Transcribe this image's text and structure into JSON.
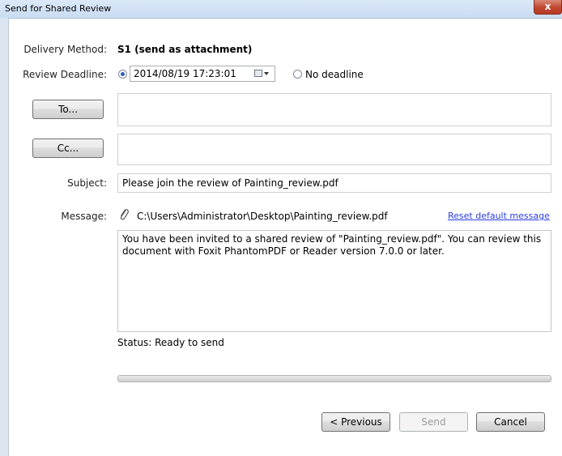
{
  "window": {
    "title": "Send for Shared Review",
    "close_glyph": "x"
  },
  "delivery": {
    "label": "Delivery Method:",
    "value": "S1 (send as attachment)"
  },
  "deadline": {
    "label": "Review Deadline:",
    "datetime": "2014/08/19  17:23:01",
    "no_deadline_label": "No deadline",
    "selected": "date"
  },
  "to_button": "To...",
  "cc_button": "Cc...",
  "to_value": "",
  "cc_value": "",
  "subject": {
    "label": "Subject:",
    "value": "Please join the review of Painting_review.pdf"
  },
  "message": {
    "label": "Message:",
    "attachment_path": "C:\\Users\\Administrator\\Desktop\\Painting_review.pdf",
    "reset_link": "Reset default message",
    "body": "You have been invited to a shared review of \"Painting_review.pdf\". You can review this document with Foxit PhantomPDF or Reader version 7.0.0 or later."
  },
  "status": "Status: Ready to send",
  "progress": 0,
  "buttons": {
    "previous": "< Previous",
    "send": "Send",
    "cancel": "Cancel"
  }
}
